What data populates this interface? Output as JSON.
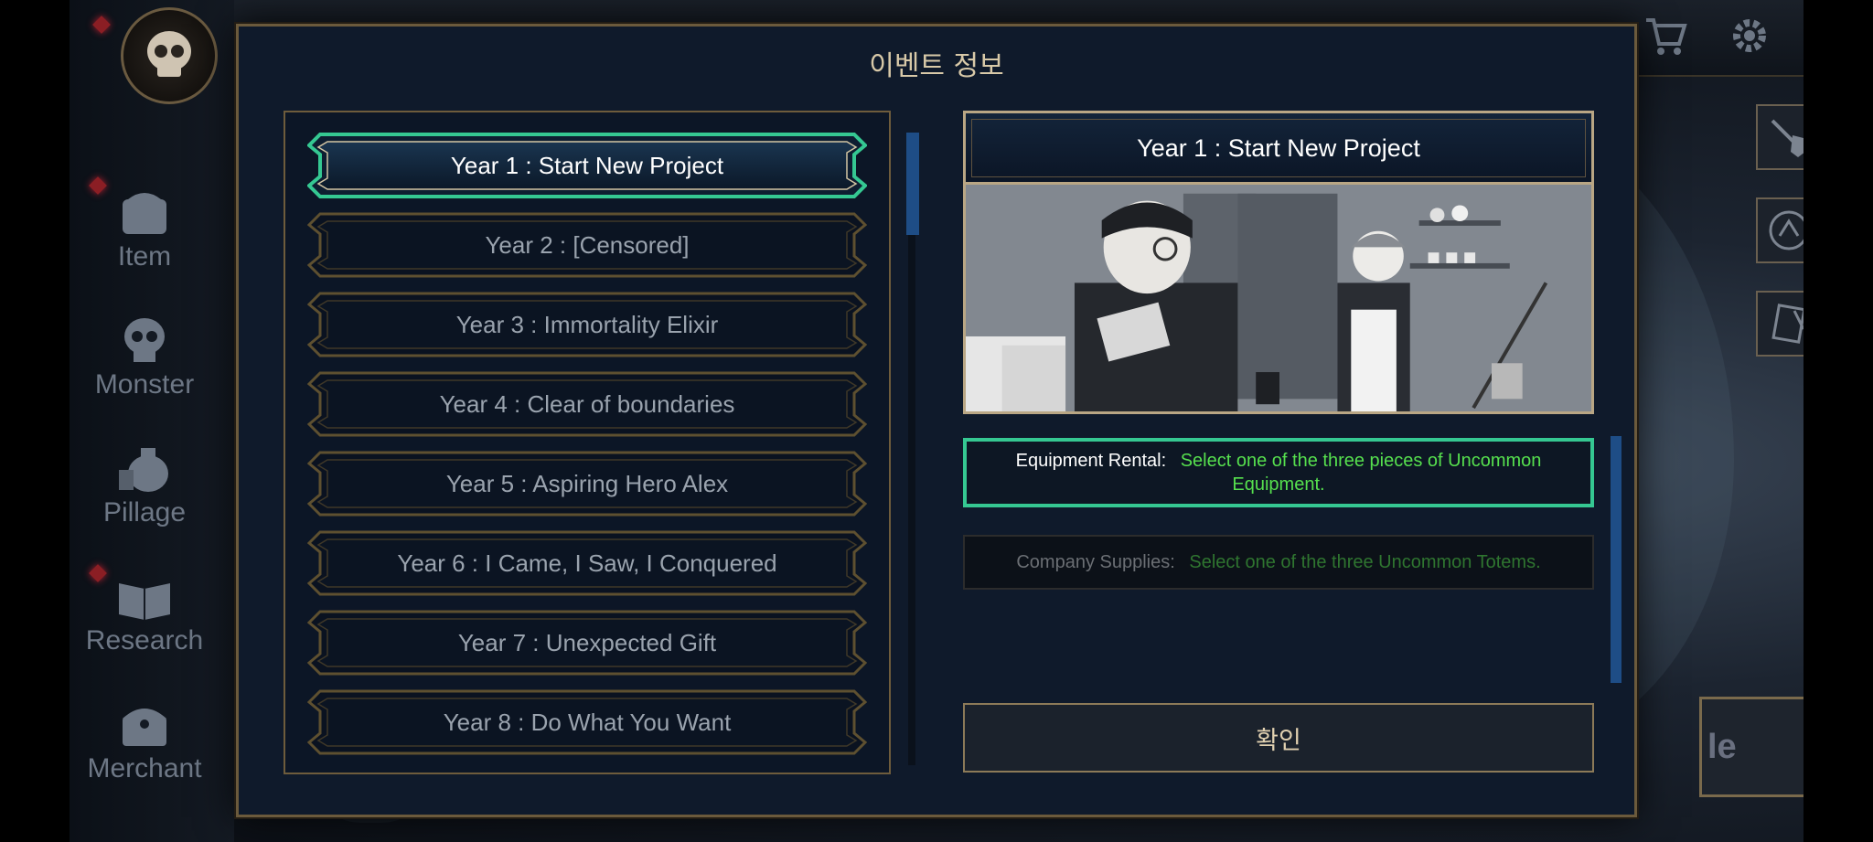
{
  "background": {
    "sidebar_items": [
      {
        "label": "Item",
        "icon": "chest-icon"
      },
      {
        "label": "Monster",
        "icon": "skull-icon"
      },
      {
        "label": "Pillage",
        "icon": "loot-bag-icon"
      },
      {
        "label": "Research",
        "icon": "book-icon"
      },
      {
        "label": "Merchant",
        "icon": "treasure-chest-icon"
      }
    ],
    "battle_label_partial": "le"
  },
  "dialog": {
    "title": "이벤트 정보",
    "events": [
      {
        "label": "Year 1 : Start New Project",
        "selected": true
      },
      {
        "label": "Year 2 : [Censored]",
        "selected": false
      },
      {
        "label": "Year 3 : Immortality Elixir",
        "selected": false
      },
      {
        "label": "Year 4 : Clear of boundaries",
        "selected": false
      },
      {
        "label": "Year 5 : Aspiring Hero Alex",
        "selected": false
      },
      {
        "label": "Year 6 : I Came, I Saw, I Conquered",
        "selected": false
      },
      {
        "label": "Year 7 : Unexpected Gift",
        "selected": false
      },
      {
        "label": "Year 8 : Do What You Want",
        "selected": false
      }
    ],
    "detail": {
      "title": "Year 1 : Start New Project",
      "rewards": [
        {
          "label": "Equipment Rental:",
          "description": "Select one of the three pieces of Uncommon Equipment.",
          "selected": true
        },
        {
          "label": "Company Supplies:",
          "description": "Select one of the three Uncommon Totems.",
          "selected": false
        }
      ]
    },
    "confirm_label": "확인"
  },
  "colors": {
    "selected_border": "#35c892",
    "reward_text_green": "#56e04e",
    "gold_border": "#b9a684",
    "scroll_blue": "#1e4d86",
    "panel_bg": "#0f1a2b"
  }
}
